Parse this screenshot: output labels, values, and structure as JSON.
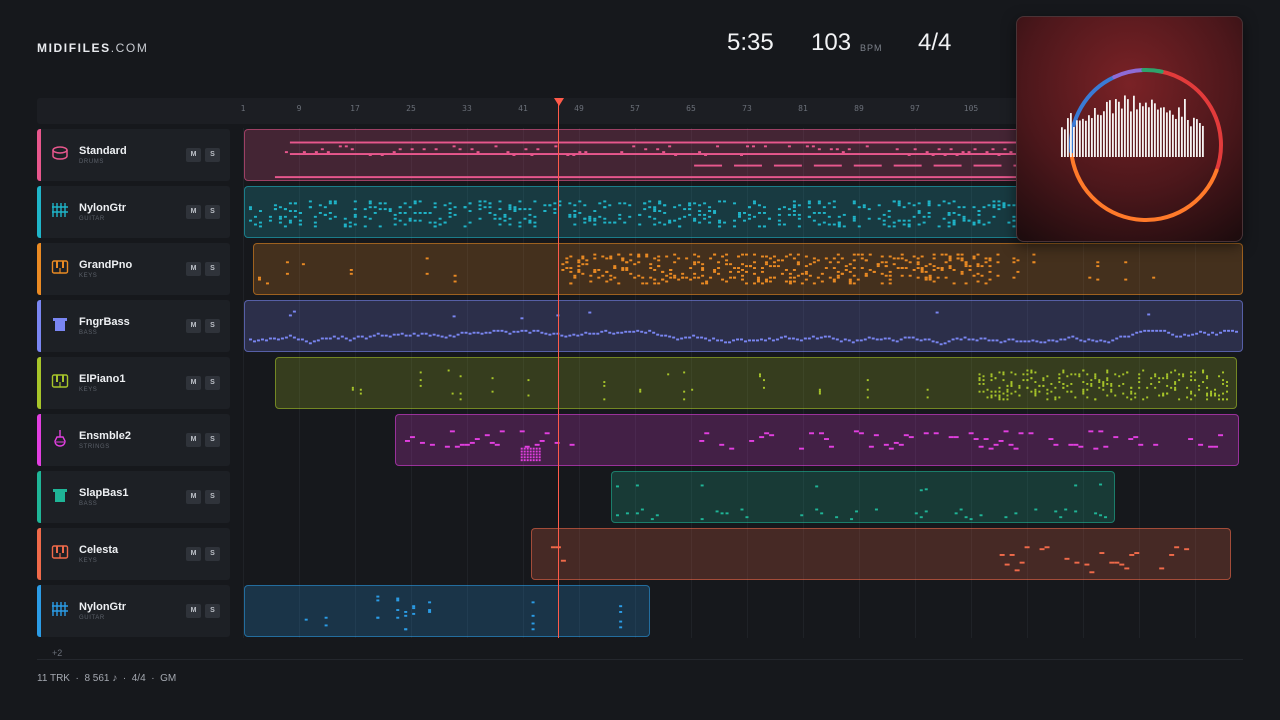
{
  "brand": {
    "bold": "MIDIFILES",
    "thin": ".COM"
  },
  "transport": {
    "time": "5:35",
    "bpm": "103",
    "bpm_unit": "BPM",
    "signature": "4/4"
  },
  "ruler": {
    "labels": [
      "1",
      "9",
      "17",
      "25",
      "33",
      "41",
      "49",
      "57",
      "65",
      "73",
      "81",
      "89",
      "97",
      "105"
    ]
  },
  "tracks": [
    {
      "name": "Standard",
      "category": "DRUMS",
      "color": "#e8578d",
      "icon": "drum-icon",
      "mute": "M",
      "solo": "S"
    },
    {
      "name": "NylonGtr",
      "category": "GUITAR",
      "color": "#1fb5c9",
      "icon": "guitar-icon",
      "mute": "M",
      "solo": "S"
    },
    {
      "name": "GrandPno",
      "category": "KEYS",
      "color": "#ea8a23",
      "icon": "keys-icon",
      "mute": "M",
      "solo": "S"
    },
    {
      "name": "FngrBass",
      "category": "BASS",
      "color": "#7a86f2",
      "icon": "bass-icon",
      "mute": "M",
      "solo": "S"
    },
    {
      "name": "ElPiano1",
      "category": "KEYS",
      "color": "#a7c52a",
      "icon": "keys-icon",
      "mute": "M",
      "solo": "S"
    },
    {
      "name": "Ensmble2",
      "category": "STRINGS",
      "color": "#e23fe0",
      "icon": "strings-icon",
      "mute": "M",
      "solo": "S"
    },
    {
      "name": "SlapBas1",
      "category": "BASS",
      "color": "#1fb597",
      "icon": "bass-icon",
      "mute": "M",
      "solo": "S"
    },
    {
      "name": "Celesta",
      "category": "KEYS",
      "color": "#f06a4a",
      "icon": "keys-icon",
      "mute": "M",
      "solo": "S"
    },
    {
      "name": "NylonGtr",
      "category": "GUITAR",
      "color": "#2b9ce6",
      "icon": "guitar-icon",
      "mute": "M",
      "solo": "S"
    }
  ],
  "more_tracks": "+2",
  "footer": {
    "tracks": "11 TRK",
    "notes": "8 561 ♪",
    "signature": "4/4",
    "standard": "GM",
    "separator": "·"
  },
  "visualizer": {
    "ring_colors": [
      "#e23b3b",
      "#ff7a2a",
      "#3a7bd5",
      "#8e6bd6",
      "#2ea36b"
    ],
    "bar_color": "#f5f3f2"
  }
}
